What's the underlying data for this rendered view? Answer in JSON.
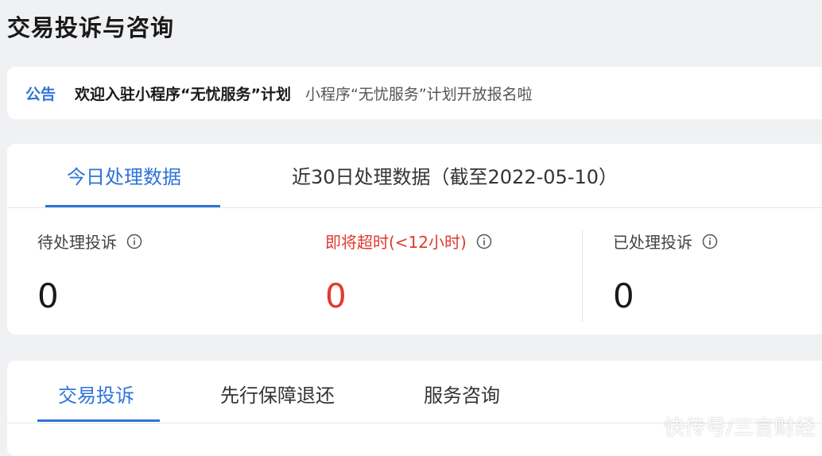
{
  "page": {
    "title": "交易投诉与咨询"
  },
  "notice": {
    "tag": "公告",
    "title": "欢迎入驻小程序“无忧服务”计划",
    "desc": "小程序“无忧服务”计划开放报名啦"
  },
  "stats_tabs": [
    {
      "label": "今日处理数据",
      "active": true
    },
    {
      "label": "近30日处理数据（截至2022-05-10）",
      "active": false
    }
  ],
  "stats": {
    "pending": {
      "label": "待处理投诉",
      "value": "0"
    },
    "expiring": {
      "label": "即将超时(<12小时)",
      "value": "0"
    },
    "processed": {
      "label": "已处理投诉",
      "value": "0"
    }
  },
  "bottom_tabs": [
    {
      "label": "交易投诉",
      "active": true
    },
    {
      "label": "先行保障退还",
      "active": false
    },
    {
      "label": "服务咨询",
      "active": false
    }
  ],
  "watermark": "快传号/三言财经",
  "colors": {
    "accent": "#2f73d8",
    "warn": "#e03a2f",
    "background": "#f0f1f3"
  },
  "icons": {
    "info": "info-circle-icon"
  }
}
